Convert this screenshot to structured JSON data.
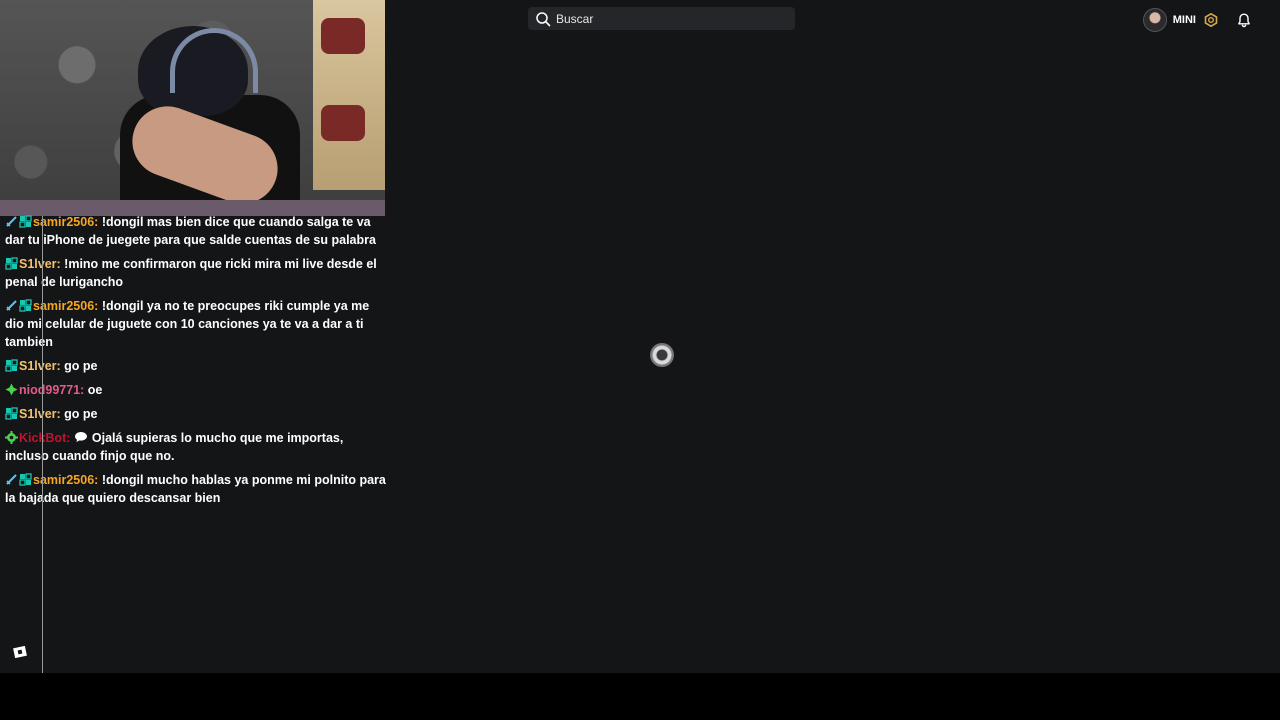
{
  "header": {
    "search": {
      "placeholder": "Buscar",
      "icon": "search-icon"
    },
    "user": {
      "name": "MINI"
    },
    "icons": {
      "coin": "coin-icon",
      "notifications": "bell-icon"
    }
  },
  "colors": {
    "background": "#141517",
    "search_bg": "#25262a",
    "username_orange": "#f5a623",
    "username_pink": "#e45a8c",
    "username_red": "#c8102e",
    "mod_badge": "#53c7f0",
    "verified_badge": "#18c7b3",
    "green_badge": "#4ad34a"
  },
  "chat": {
    "messages": [
      {
        "badges": [
          "sword",
          "sub"
        ],
        "user": "samir2506",
        "color": "#f5a623",
        "text": "!dongil mas bien dice que cuando salga te va dar tu iPhone de juegete para que salde cuentas de su palabra"
      },
      {
        "badges": [
          "sub"
        ],
        "user": "S1lver",
        "color": "#f5c36a",
        "text": "!mino me confirmaron que ricki mira mi live desde el penal de lurigancho"
      },
      {
        "badges": [
          "sword",
          "sub"
        ],
        "user": "samir2506",
        "color": "#f5a623",
        "text": "!dongil ya no te preocupes riki cumple ya me dio mi celular de juguete con 10 canciones ya te va a dar a ti tambien"
      },
      {
        "badges": [
          "sub"
        ],
        "user": "S1lver",
        "color": "#f5c36a",
        "text": "go pe"
      },
      {
        "badges": [
          "green"
        ],
        "user": "niod99771",
        "color": "#e45a8c",
        "text": "oe"
      },
      {
        "badges": [
          "sub"
        ],
        "user": "S1lver",
        "color": "#f5c36a",
        "text": "go pe"
      },
      {
        "badges": [
          "gear"
        ],
        "user": "KickBot",
        "color": "#c8102e",
        "text": "Ojalá supieras lo mucho que me importas, incluso cuando finjo que no."
      },
      {
        "badges": [
          "sword",
          "sub"
        ],
        "user": "samir2506",
        "color": "#f5a623",
        "text": "!dongil mucho hablas ya ponme mi polnito para la bajada que quiero descansar bien"
      }
    ]
  }
}
